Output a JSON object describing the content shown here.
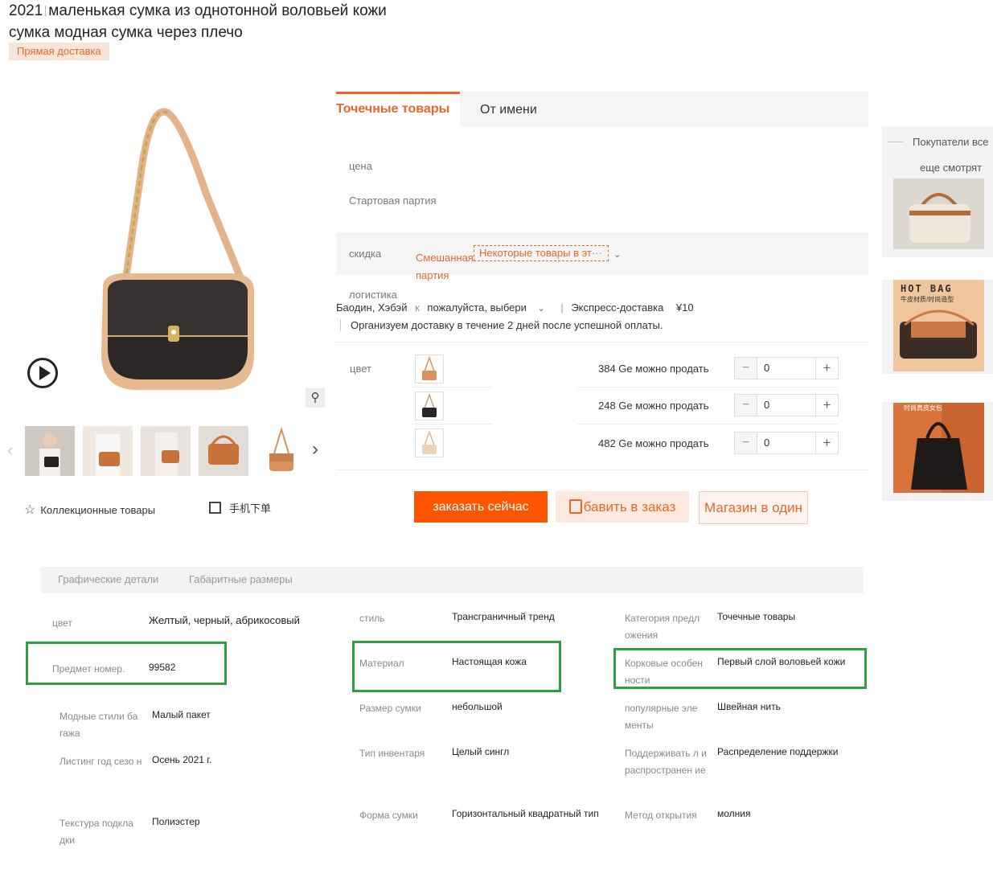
{
  "product": {
    "title_year": "2021",
    "title_line1": "маленькая сумка из однотонной воловьей кожи",
    "title_line2": "сумка модная сумка через плечо",
    "badge": "Прямая доставка"
  },
  "gallery": {
    "collect": "Коллекционные товары",
    "mobile_order": "手机下单"
  },
  "tabs": {
    "spot": "Точечные товары",
    "on_behalf": "От имени"
  },
  "purchase": {
    "price_label": "цена",
    "min_batch_label": "Стартовая партия",
    "discount_label": "скидка",
    "mixed_batch": "Смешанная партия",
    "some_goods": "Некоторые товары в эт···",
    "logistics_label": "логистика",
    "origin": "Баодин, Хэбэй",
    "to": "к",
    "choose": "пожалуйста, выбери",
    "express": "Экспресс-доставка",
    "fee": "¥10",
    "note": "Организуем доставку в течение 2 дней после успешной оплаты.",
    "color_label": "цвет",
    "variants": [
      {
        "stock": "384 Ge можно продать",
        "qty": "0",
        "color": "#d9925c"
      },
      {
        "stock": "248 Ge можно продать",
        "qty": "0",
        "color": "#2a2625"
      },
      {
        "stock": "482 Ge можно продать",
        "qty": "0",
        "color": "#e8c7a8"
      }
    ],
    "order_now": "заказать сейчас",
    "add_to_order": "бавить в заказ",
    "shop_one": "Магазин в один"
  },
  "sidebar": {
    "title_line1": "Покупатели все",
    "title_line2": "еще смотрят",
    "ad2_text": "HOT BAG",
    "ad2_sub": "牛皮材质/时尚造型",
    "ad3_text": "时尚真皮女包"
  },
  "details": {
    "tab1": "Графические детали",
    "tab2": "Габаритные размеры",
    "col1": [
      {
        "k": "цвет",
        "v": "Желтый, черный, абрикосовый"
      },
      {
        "k": "Предмет номер.",
        "v": "99582"
      },
      {
        "k": "Модные стили ба гажа",
        "v": "Малый пакет"
      },
      {
        "k": "Листинг год сезо н",
        "v": "Осень 2021 г."
      },
      {
        "k": "Текстура подкла дки",
        "v": "Полиэстер"
      }
    ],
    "col2": [
      {
        "k": "стиль",
        "v": "Трансграничный тренд"
      },
      {
        "k": "Материал",
        "v": "Настоящая кожа"
      },
      {
        "k": "Размер сумки",
        "v": "небольшой"
      },
      {
        "k": "Тип инвентаря",
        "v": "Целый сингл"
      },
      {
        "k": "Форма сумки",
        "v": "Горизонтальный квадратный тип"
      }
    ],
    "col3": [
      {
        "k": "Категория предл ожения",
        "v": "Точечные товары"
      },
      {
        "k": "Корковые особен ности",
        "v": "Первый слой воловьей кожи"
      },
      {
        "k": "популярные эле менты",
        "v": "Швейная нить"
      },
      {
        "k": "Поддерживать л и распространен ие",
        "v": "Распределение поддержки"
      },
      {
        "k": "Метод открытия",
        "v": "молния"
      }
    ]
  }
}
